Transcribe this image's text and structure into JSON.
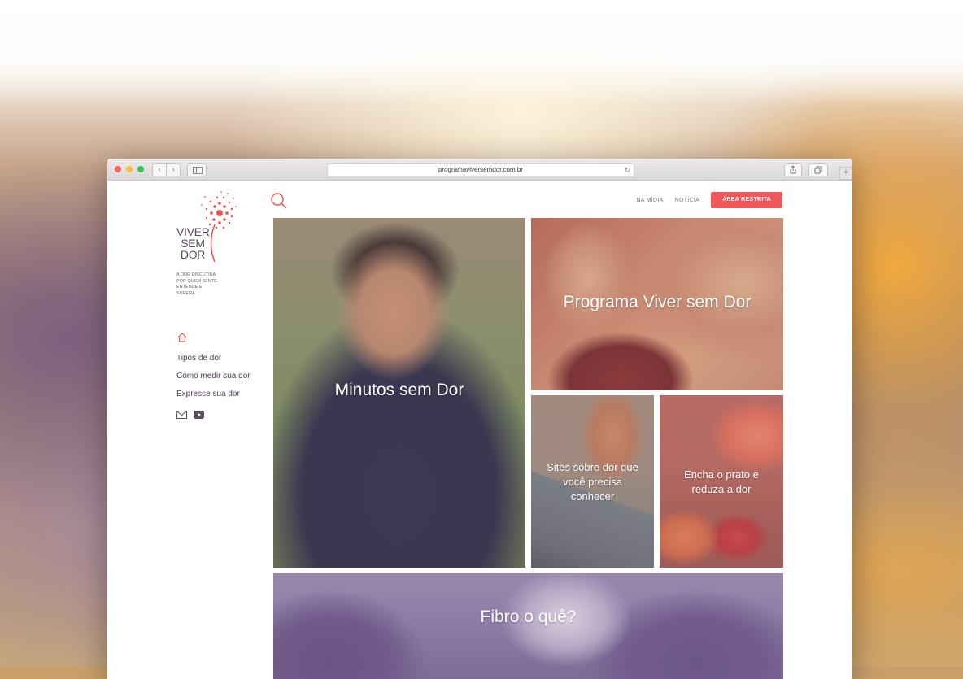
{
  "browser": {
    "url": "programaviversemdor.com.br",
    "back_glyph": "‹",
    "forward_glyph": "›",
    "plus_glyph": "+"
  },
  "brand": {
    "logo_line1": "VIVER",
    "logo_line2": "SEM",
    "logo_line3": "DOR",
    "tagline_line1": "A DOR DISCUTIDA",
    "tagline_line2": "POR QUEM SENTE,",
    "tagline_line3": "ENTENDE E",
    "tagline_line4": "SUPERA",
    "accent_color": "#f0595b"
  },
  "menu": {
    "items": [
      {
        "label": "Tipos de dor"
      },
      {
        "label": "Como medir sua dor"
      },
      {
        "label": "Expresse sua dor"
      }
    ]
  },
  "topnav": {
    "na_midia": "NA MÍDIA",
    "noticia": "NOTÍCIA",
    "area_restrita": "ÁREA RESTRITA"
  },
  "tiles": {
    "minutos": "Minutos sem Dor",
    "programa": "Programa Viver sem Dor",
    "sites": "Sites sobre dor que você precisa conhecer",
    "encha": "Encha o prato e reduza a dor",
    "fibro": "Fibro o quê?"
  },
  "icons": {
    "home": "home-icon",
    "search": "search-icon",
    "email": "email-icon",
    "youtube": "youtube-icon"
  }
}
